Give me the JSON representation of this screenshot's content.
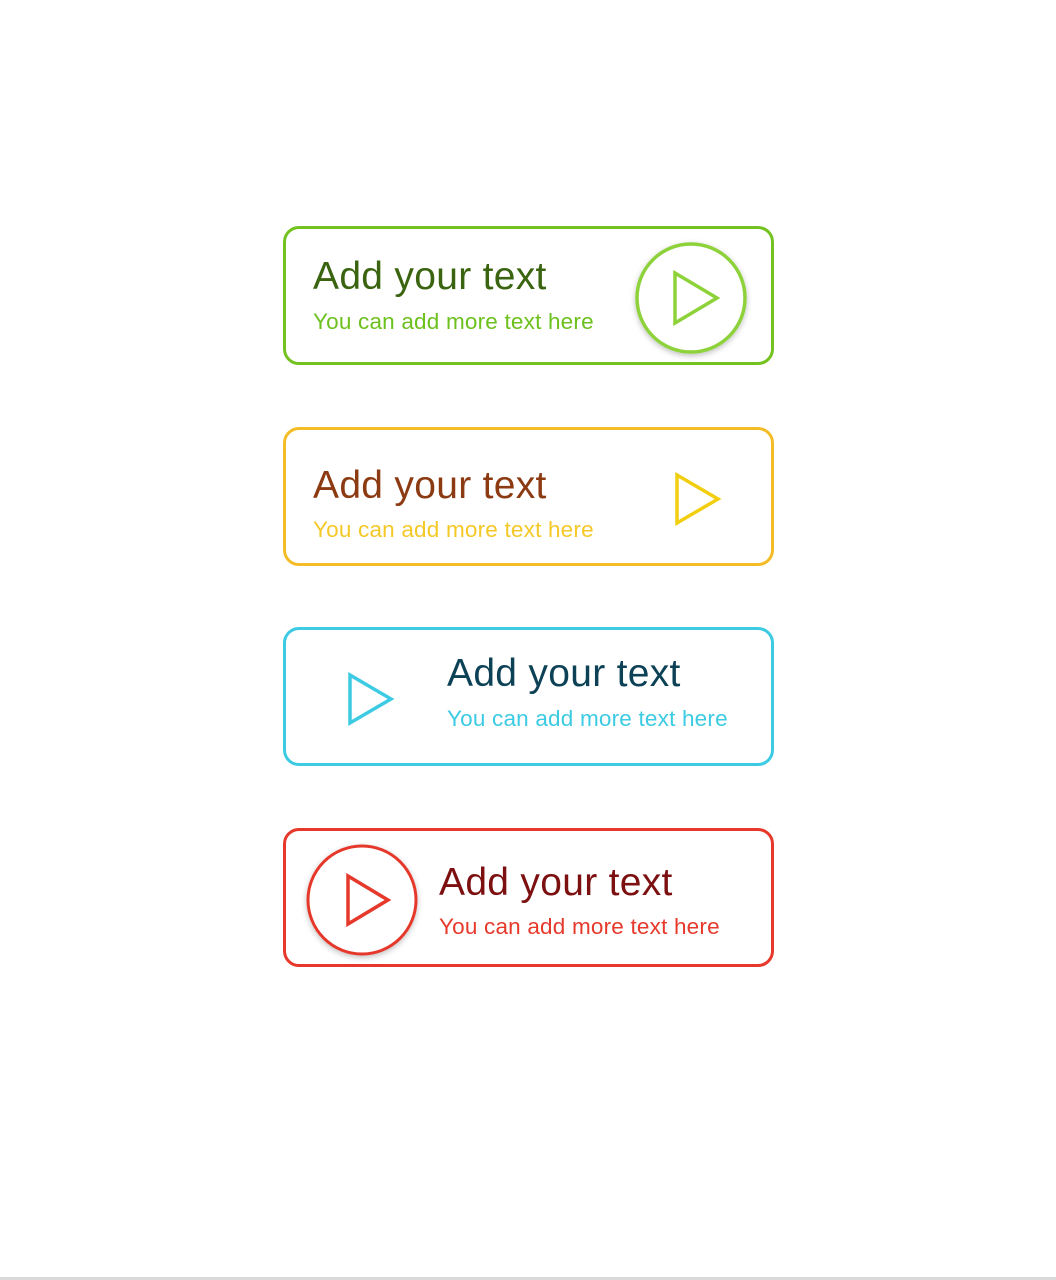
{
  "cards": [
    {
      "title": "Add your text",
      "subtitle": "You can add more text here",
      "border_color": "#74c21f",
      "title_color": "#3a6410",
      "subtitle_color": "#6cc11e",
      "icon": "play-icon",
      "icon_color": "#8ed23a",
      "icon_style": "circle",
      "icon_position": "right"
    },
    {
      "title": "Add your text",
      "subtitle": "You can add more text here",
      "border_color": "#f4bd28",
      "title_color": "#8c3a12",
      "subtitle_color": "#f4c827",
      "icon": "play-icon",
      "icon_color": "#f2ce10",
      "icon_style": "plain",
      "icon_position": "right"
    },
    {
      "title": "Add your text",
      "subtitle": "You can add more text here",
      "border_color": "#3ccbe2",
      "title_color": "#0d4256",
      "subtitle_color": "#3ccbe2",
      "icon": "play-icon",
      "icon_color": "#3ccbe2",
      "icon_style": "plain",
      "icon_position": "left"
    },
    {
      "title": "Add your text",
      "subtitle": "You can add more text here",
      "border_color": "#e6392b",
      "title_color": "#7c1010",
      "subtitle_color": "#e6392b",
      "icon": "play-icon",
      "icon_color": "#e6392b",
      "icon_style": "circle",
      "icon_position": "left"
    }
  ]
}
